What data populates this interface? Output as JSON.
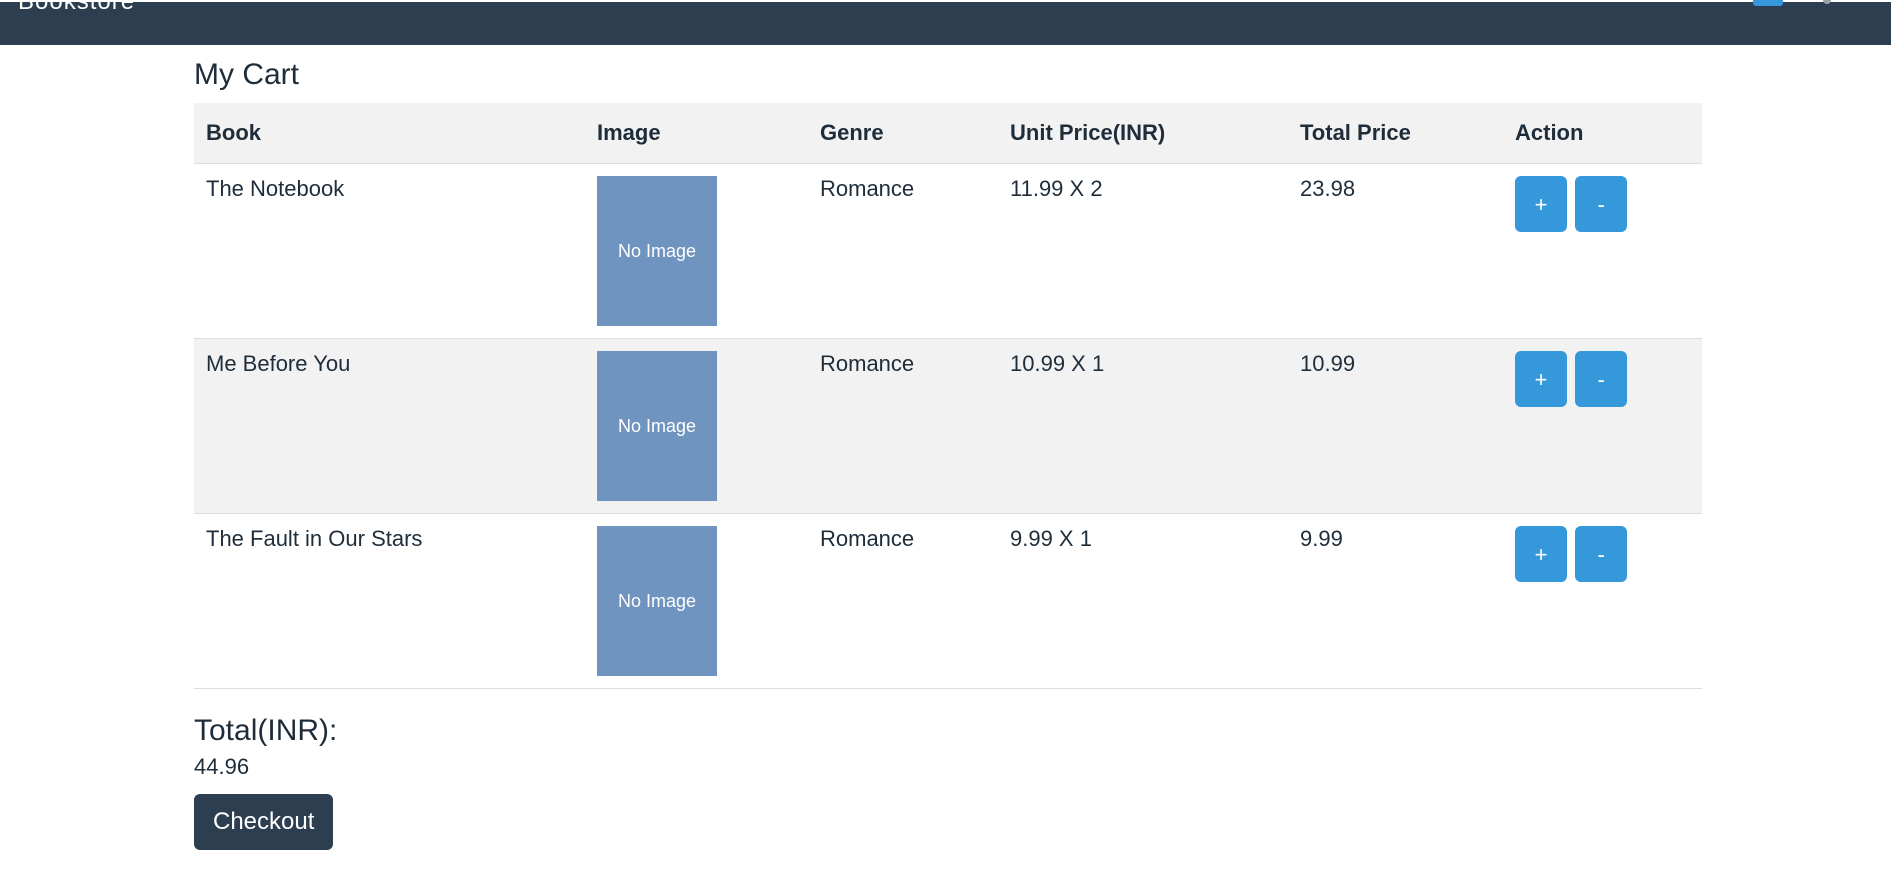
{
  "navbar": {
    "brand": "Bookstore"
  },
  "cart": {
    "title": "My Cart",
    "columns": [
      "Book",
      "Image",
      "Genre",
      "Unit Price(INR)",
      "Total Price",
      "Action"
    ],
    "items": [
      {
        "book": "The Notebook",
        "image_placeholder": "No Image",
        "genre": "Romance",
        "unit_price": "11.99 X 2",
        "total_price": "23.98",
        "add_label": "+",
        "remove_label": "-"
      },
      {
        "book": "Me Before You",
        "image_placeholder": "No Image",
        "genre": "Romance",
        "unit_price": "10.99 X 1",
        "total_price": "10.99",
        "add_label": "+",
        "remove_label": "-"
      },
      {
        "book": "The Fault in Our Stars",
        "image_placeholder": "No Image",
        "genre": "Romance",
        "unit_price": "9.99 X 1",
        "total_price": "9.99",
        "add_label": "+",
        "remove_label": "-"
      }
    ],
    "total_label": "Total(INR):",
    "total_value": "44.96",
    "checkout_label": "Checkout"
  },
  "colors": {
    "navbar": "#2c3e50",
    "accent": "#3498db",
    "image_placeholder": "#7094c0"
  }
}
